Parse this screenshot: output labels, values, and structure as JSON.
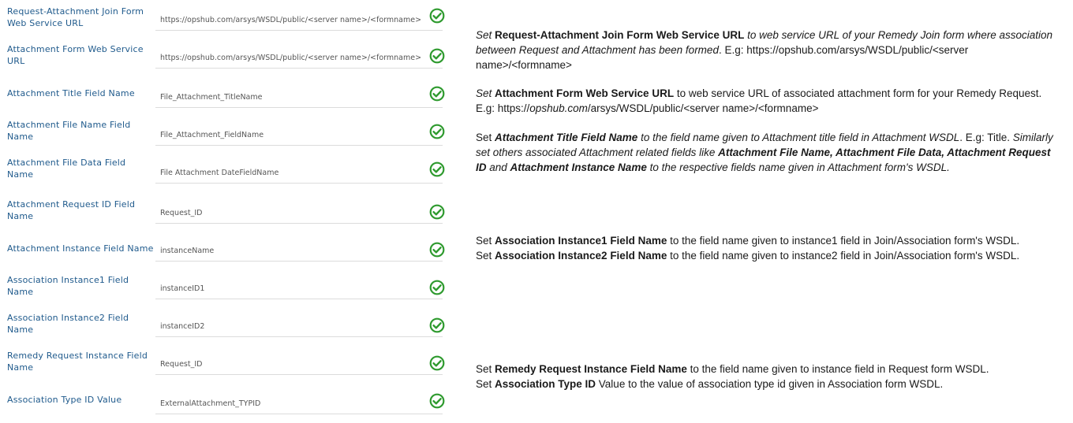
{
  "fields": [
    {
      "label": "Request-Attachment Join Form Web Service URL",
      "value": "https://opshub.com/arsys/WSDL/public/<server name>/<formname>"
    },
    {
      "label": "Attachment Form Web Service URL",
      "value": "https://opshub.com/arsys/WSDL/public/<server name>/<formname>"
    },
    {
      "label": "Attachment Title Field Name",
      "value": "File_Attachment_TitleName"
    },
    {
      "label": "Attachment File Name Field Name",
      "value": "File_Attachment_FieldName"
    },
    {
      "label": "Attachment File Data Field Name",
      "value": "File Attachment DateFieldName"
    },
    {
      "label": "Attachment Request ID Field Name",
      "value": "Request_ID"
    },
    {
      "label": "Attachment Instance Field Name",
      "value": "instanceName"
    },
    {
      "label": "Association Instance1 Field Name",
      "value": "instanceID1"
    },
    {
      "label": "Association Instance2 Field Name",
      "value": "instanceID2"
    },
    {
      "label": "Remedy Request Instance Field Name",
      "value": "Request_ID"
    },
    {
      "label": "Association Type ID Value",
      "value": "ExternalAttachment_TYPID"
    }
  ],
  "notes": {
    "n1": {
      "a": "Set ",
      "b": "Request-Attachment Join Form Web Service URL",
      "c": " to web service URL of your Remedy Join form where association between Request and Attachment has been formed",
      "d": ". E.g: https://opshub.com/arsys/WSDL/public/<server name>/<formname>"
    },
    "n2": {
      "a": "Set ",
      "b": "Attachment Form Web Service URL",
      "c": " to web service URL of associated attachment form for your Remedy Request. E.g: https://",
      "d": "opshub.com",
      "e": "/arsys/WSDL/public/<server name>/<formname>"
    },
    "n3": {
      "a": "Set ",
      "b": "Attachment Title Field Name",
      "c": " to the field name given to Attachment title field in Attachment WSDL",
      "d": ". E.g: Title. ",
      "e": "Similarly set others associated Attachment related fields like ",
      "f": "Attachment File Name, Attachment File Data, Attachment Request ID",
      "g": " and ",
      "h": "Attachment Instance Name",
      "i": " to the respective fields name given in Attachment form's WSDL."
    },
    "n4": {
      "l1a": "Set ",
      "l1b": "Association Instance1 Field Name",
      "l1c": " to the field name given to instance1 field in Join/Association form's WSDL.",
      "l2a": "Set ",
      "l2b": "Association Instance2 Field Name",
      "l2c": " to the field name given to instance2 field in Join/Association form's WSDL."
    },
    "n5": {
      "l1a": "Set ",
      "l1b": "Remedy Request Instance Field Name",
      "l1c": " to the field name given to instance field in Request form WSDL.",
      "l2a": "Set ",
      "l2b": "Association Type ID",
      "l2c": " Value to the value of association type id given in Association form WSDL."
    }
  },
  "colors": {
    "label": "#1f5a8c",
    "check": "#2e9a2e"
  }
}
